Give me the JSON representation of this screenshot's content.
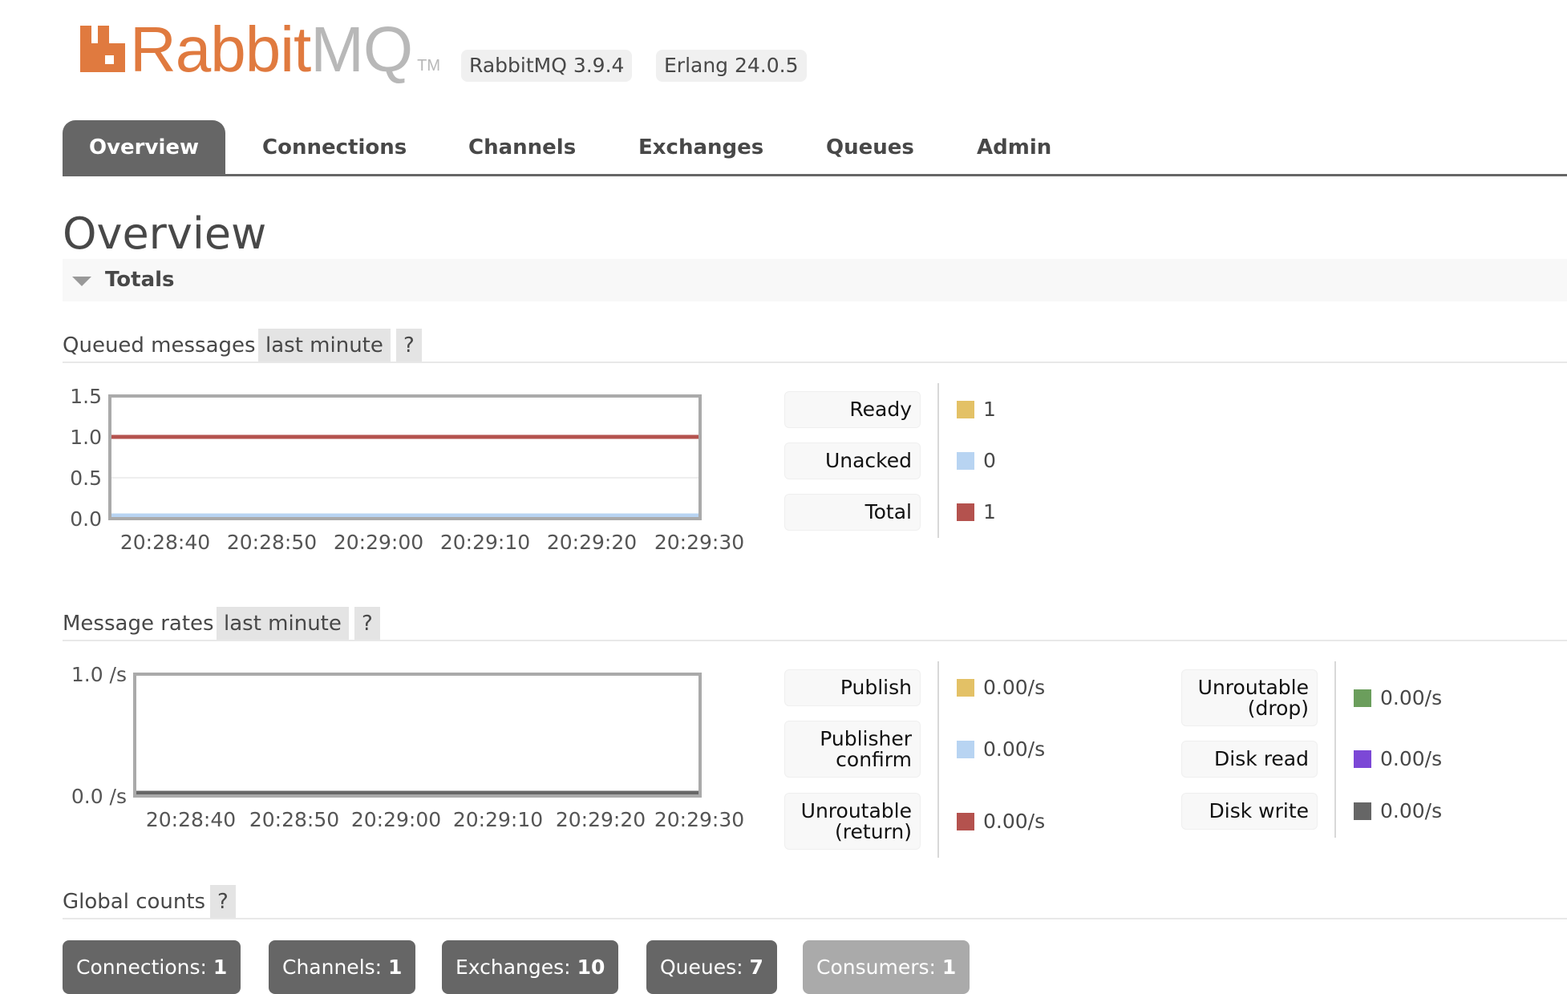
{
  "header": {
    "logo_word_1": "Rabbit",
    "logo_word_2": "MQ",
    "logo_tm": "TM",
    "version_badge": "RabbitMQ 3.9.4",
    "erlang_badge": "Erlang 24.0.5",
    "brand_color": "#e07a3f"
  },
  "tabs": [
    {
      "label": "Overview",
      "active": true
    },
    {
      "label": "Connections",
      "active": false
    },
    {
      "label": "Channels",
      "active": false
    },
    {
      "label": "Exchanges",
      "active": false
    },
    {
      "label": "Queues",
      "active": false
    },
    {
      "label": "Admin",
      "active": false
    }
  ],
  "page": {
    "title": "Overview",
    "totals_label": "Totals"
  },
  "queued": {
    "title": "Queued messages",
    "range": "last minute",
    "help": "?",
    "legend": [
      {
        "label": "Ready",
        "color": "#e3c166",
        "value": "1"
      },
      {
        "label": "Unacked",
        "color": "#b8d4f2",
        "value": "0"
      },
      {
        "label": "Total",
        "color": "#b4524e",
        "value": "1"
      }
    ]
  },
  "rates": {
    "title": "Message rates",
    "range": "last minute",
    "help": "?",
    "legend_col1": [
      {
        "label": "Publish",
        "color": "#e3c166",
        "value": "0.00/s"
      },
      {
        "label": "Publisher confirm",
        "color": "#b8d4f2",
        "value": "0.00/s"
      },
      {
        "label": "Unroutable (return)",
        "color": "#b4524e",
        "value": "0.00/s"
      }
    ],
    "legend_col2": [
      {
        "label": "Unroutable (drop)",
        "color": "#6b9e5c",
        "value": "0.00/s"
      },
      {
        "label": "Disk read",
        "color": "#7c48d6",
        "value": "0.00/s"
      },
      {
        "label": "Disk write",
        "color": "#666666",
        "value": "0.00/s"
      }
    ]
  },
  "global": {
    "title": "Global counts",
    "help": "?",
    "counts": [
      {
        "label": "Connections:",
        "value": "1",
        "dim": false
      },
      {
        "label": "Channels:",
        "value": "1",
        "dim": false
      },
      {
        "label": "Exchanges:",
        "value": "10",
        "dim": false
      },
      {
        "label": "Queues:",
        "value": "7",
        "dim": false
      },
      {
        "label": "Consumers:",
        "value": "1",
        "dim": true
      }
    ]
  },
  "chart_data": [
    {
      "type": "line",
      "title": "Queued messages",
      "xlabel": "",
      "ylabel": "",
      "x": [
        "20:28:40",
        "20:28:50",
        "20:29:00",
        "20:29:10",
        "20:29:20",
        "20:29:30"
      ],
      "x_range": [
        "20:28:35",
        "20:29:30"
      ],
      "yticks": [
        "0.0",
        "0.5",
        "1.0",
        "1.5"
      ],
      "ylim": [
        0,
        1.5
      ],
      "grid": true,
      "legend": "right",
      "series": [
        {
          "name": "Ready",
          "color": "#e3c166",
          "values": [
            1,
            1,
            1,
            1,
            1,
            1
          ]
        },
        {
          "name": "Unacked",
          "color": "#b8d4f2",
          "values": [
            0,
            0,
            0,
            0,
            0,
            0
          ]
        },
        {
          "name": "Total",
          "color": "#b4524e",
          "values": [
            1,
            1,
            1,
            1,
            1,
            1
          ]
        }
      ]
    },
    {
      "type": "line",
      "title": "Message rates",
      "xlabel": "",
      "ylabel": "",
      "x": [
        "20:28:40",
        "20:28:50",
        "20:29:00",
        "20:29:10",
        "20:29:20",
        "20:29:30"
      ],
      "x_range": [
        "20:28:35",
        "20:29:30"
      ],
      "yticks": [
        "0.0 /s",
        "1.0 /s"
      ],
      "ylim": [
        0,
        1
      ],
      "grid": false,
      "legend": "right",
      "series": [
        {
          "name": "Publish",
          "color": "#e3c166",
          "values": [
            0,
            0,
            0,
            0,
            0,
            0
          ]
        },
        {
          "name": "Publisher confirm",
          "color": "#b8d4f2",
          "values": [
            0,
            0,
            0,
            0,
            0,
            0
          ]
        },
        {
          "name": "Unroutable (return)",
          "color": "#b4524e",
          "values": [
            0,
            0,
            0,
            0,
            0,
            0
          ]
        },
        {
          "name": "Unroutable (drop)",
          "color": "#6b9e5c",
          "values": [
            0,
            0,
            0,
            0,
            0,
            0
          ]
        },
        {
          "name": "Disk read",
          "color": "#7c48d6",
          "values": [
            0,
            0,
            0,
            0,
            0,
            0
          ]
        },
        {
          "name": "Disk write",
          "color": "#666666",
          "values": [
            0,
            0,
            0,
            0,
            0,
            0
          ]
        }
      ]
    }
  ]
}
